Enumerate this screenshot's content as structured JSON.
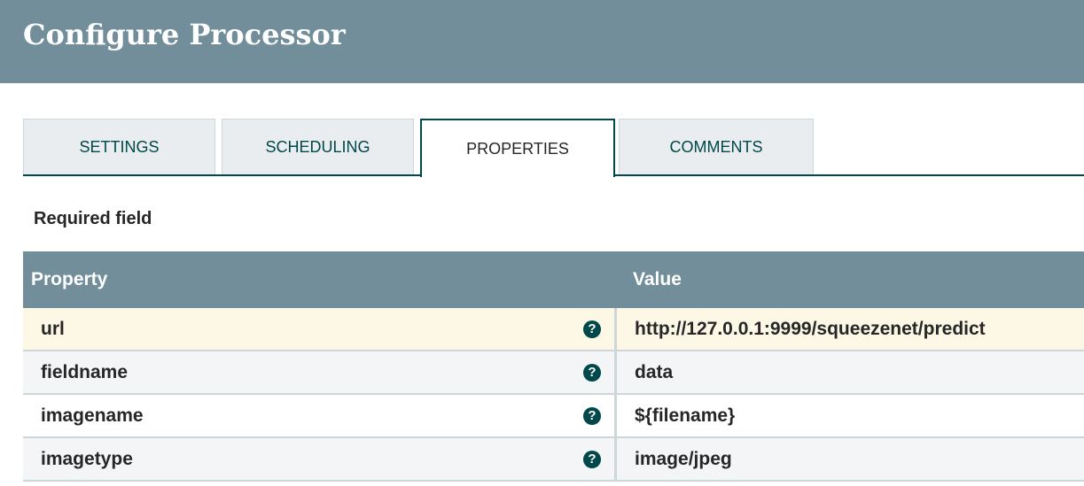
{
  "title": "Configure Processor",
  "tabs": [
    {
      "label": "SETTINGS"
    },
    {
      "label": "SCHEDULING"
    },
    {
      "label": "PROPERTIES"
    },
    {
      "label": "COMMENTS"
    }
  ],
  "required_label": "Required field",
  "table": {
    "headers": {
      "property": "Property",
      "value": "Value"
    },
    "rows": [
      {
        "property": "url",
        "value": "http://127.0.0.1:9999/squeezenet/predict"
      },
      {
        "property": "fieldname",
        "value": "data"
      },
      {
        "property": "imagename",
        "value": "${filename}"
      },
      {
        "property": "imagetype",
        "value": "image/jpeg"
      }
    ]
  },
  "help_glyph": "?",
  "colors": {
    "header": "#728e9b",
    "accent": "#004849",
    "selected_row": "#fdf8e6"
  }
}
